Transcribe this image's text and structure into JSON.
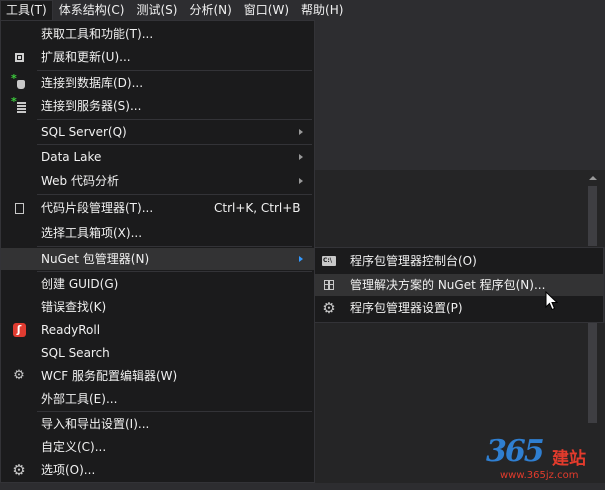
{
  "menubar": {
    "items": [
      {
        "label": "工具(T)"
      },
      {
        "label": "体系结构(C)"
      },
      {
        "label": "测试(S)"
      },
      {
        "label": "分析(N)"
      },
      {
        "label": "窗口(W)"
      },
      {
        "label": "帮助(H)"
      }
    ]
  },
  "tools_menu": {
    "items": [
      {
        "label": "获取工具和功能(T)...",
        "icon": "none"
      },
      {
        "label": "扩展和更新(U)...",
        "icon": "extensions-icon"
      },
      {
        "label": "连接到数据库(D)...",
        "icon": "connect-database-icon"
      },
      {
        "label": "连接到服务器(S)...",
        "icon": "connect-server-icon"
      },
      {
        "label": "SQL Server(Q)",
        "icon": "none",
        "submenu": true
      },
      {
        "label": "Data Lake",
        "icon": "none",
        "submenu": true
      },
      {
        "label": "Web 代码分析",
        "icon": "none",
        "submenu": true
      },
      {
        "label": "代码片段管理器(T)...",
        "icon": "code-snippet-icon",
        "shortcut": "Ctrl+K, Ctrl+B"
      },
      {
        "label": "选择工具箱项(X)...",
        "icon": "none"
      },
      {
        "label": "NuGet 包管理器(N)",
        "icon": "none",
        "submenu": true,
        "highlighted": true
      },
      {
        "label": "创建 GUID(G)",
        "icon": "none"
      },
      {
        "label": "错误查找(K)",
        "icon": "none"
      },
      {
        "label": "ReadyRoll",
        "icon": "readyroll-icon"
      },
      {
        "label": "SQL Search",
        "icon": "none"
      },
      {
        "label": "WCF 服务配置编辑器(W)",
        "icon": "wcf-config-icon"
      },
      {
        "label": "外部工具(E)...",
        "icon": "none"
      },
      {
        "label": "导入和导出设置(I)...",
        "icon": "none"
      },
      {
        "label": "自定义(C)...",
        "icon": "none"
      },
      {
        "label": "选项(O)...",
        "icon": "gear-icon"
      }
    ]
  },
  "nuget_submenu": {
    "items": [
      {
        "label": "程序包管理器控制台(O)",
        "icon": "console-icon"
      },
      {
        "label": "管理解决方案的 NuGet 程序包(N)...",
        "icon": "package-icon",
        "highlighted": true
      },
      {
        "label": "程序包管理器设置(P)",
        "icon": "gear-icon"
      }
    ]
  },
  "watermark": {
    "number": "365",
    "text": "建站",
    "url": "www.365jz.com"
  },
  "colors": {
    "background": "#2d2d30",
    "menu_bg": "#1b1b1c",
    "highlight": "#333334",
    "accent": "#3399ff",
    "readyroll": "#e03c31"
  }
}
